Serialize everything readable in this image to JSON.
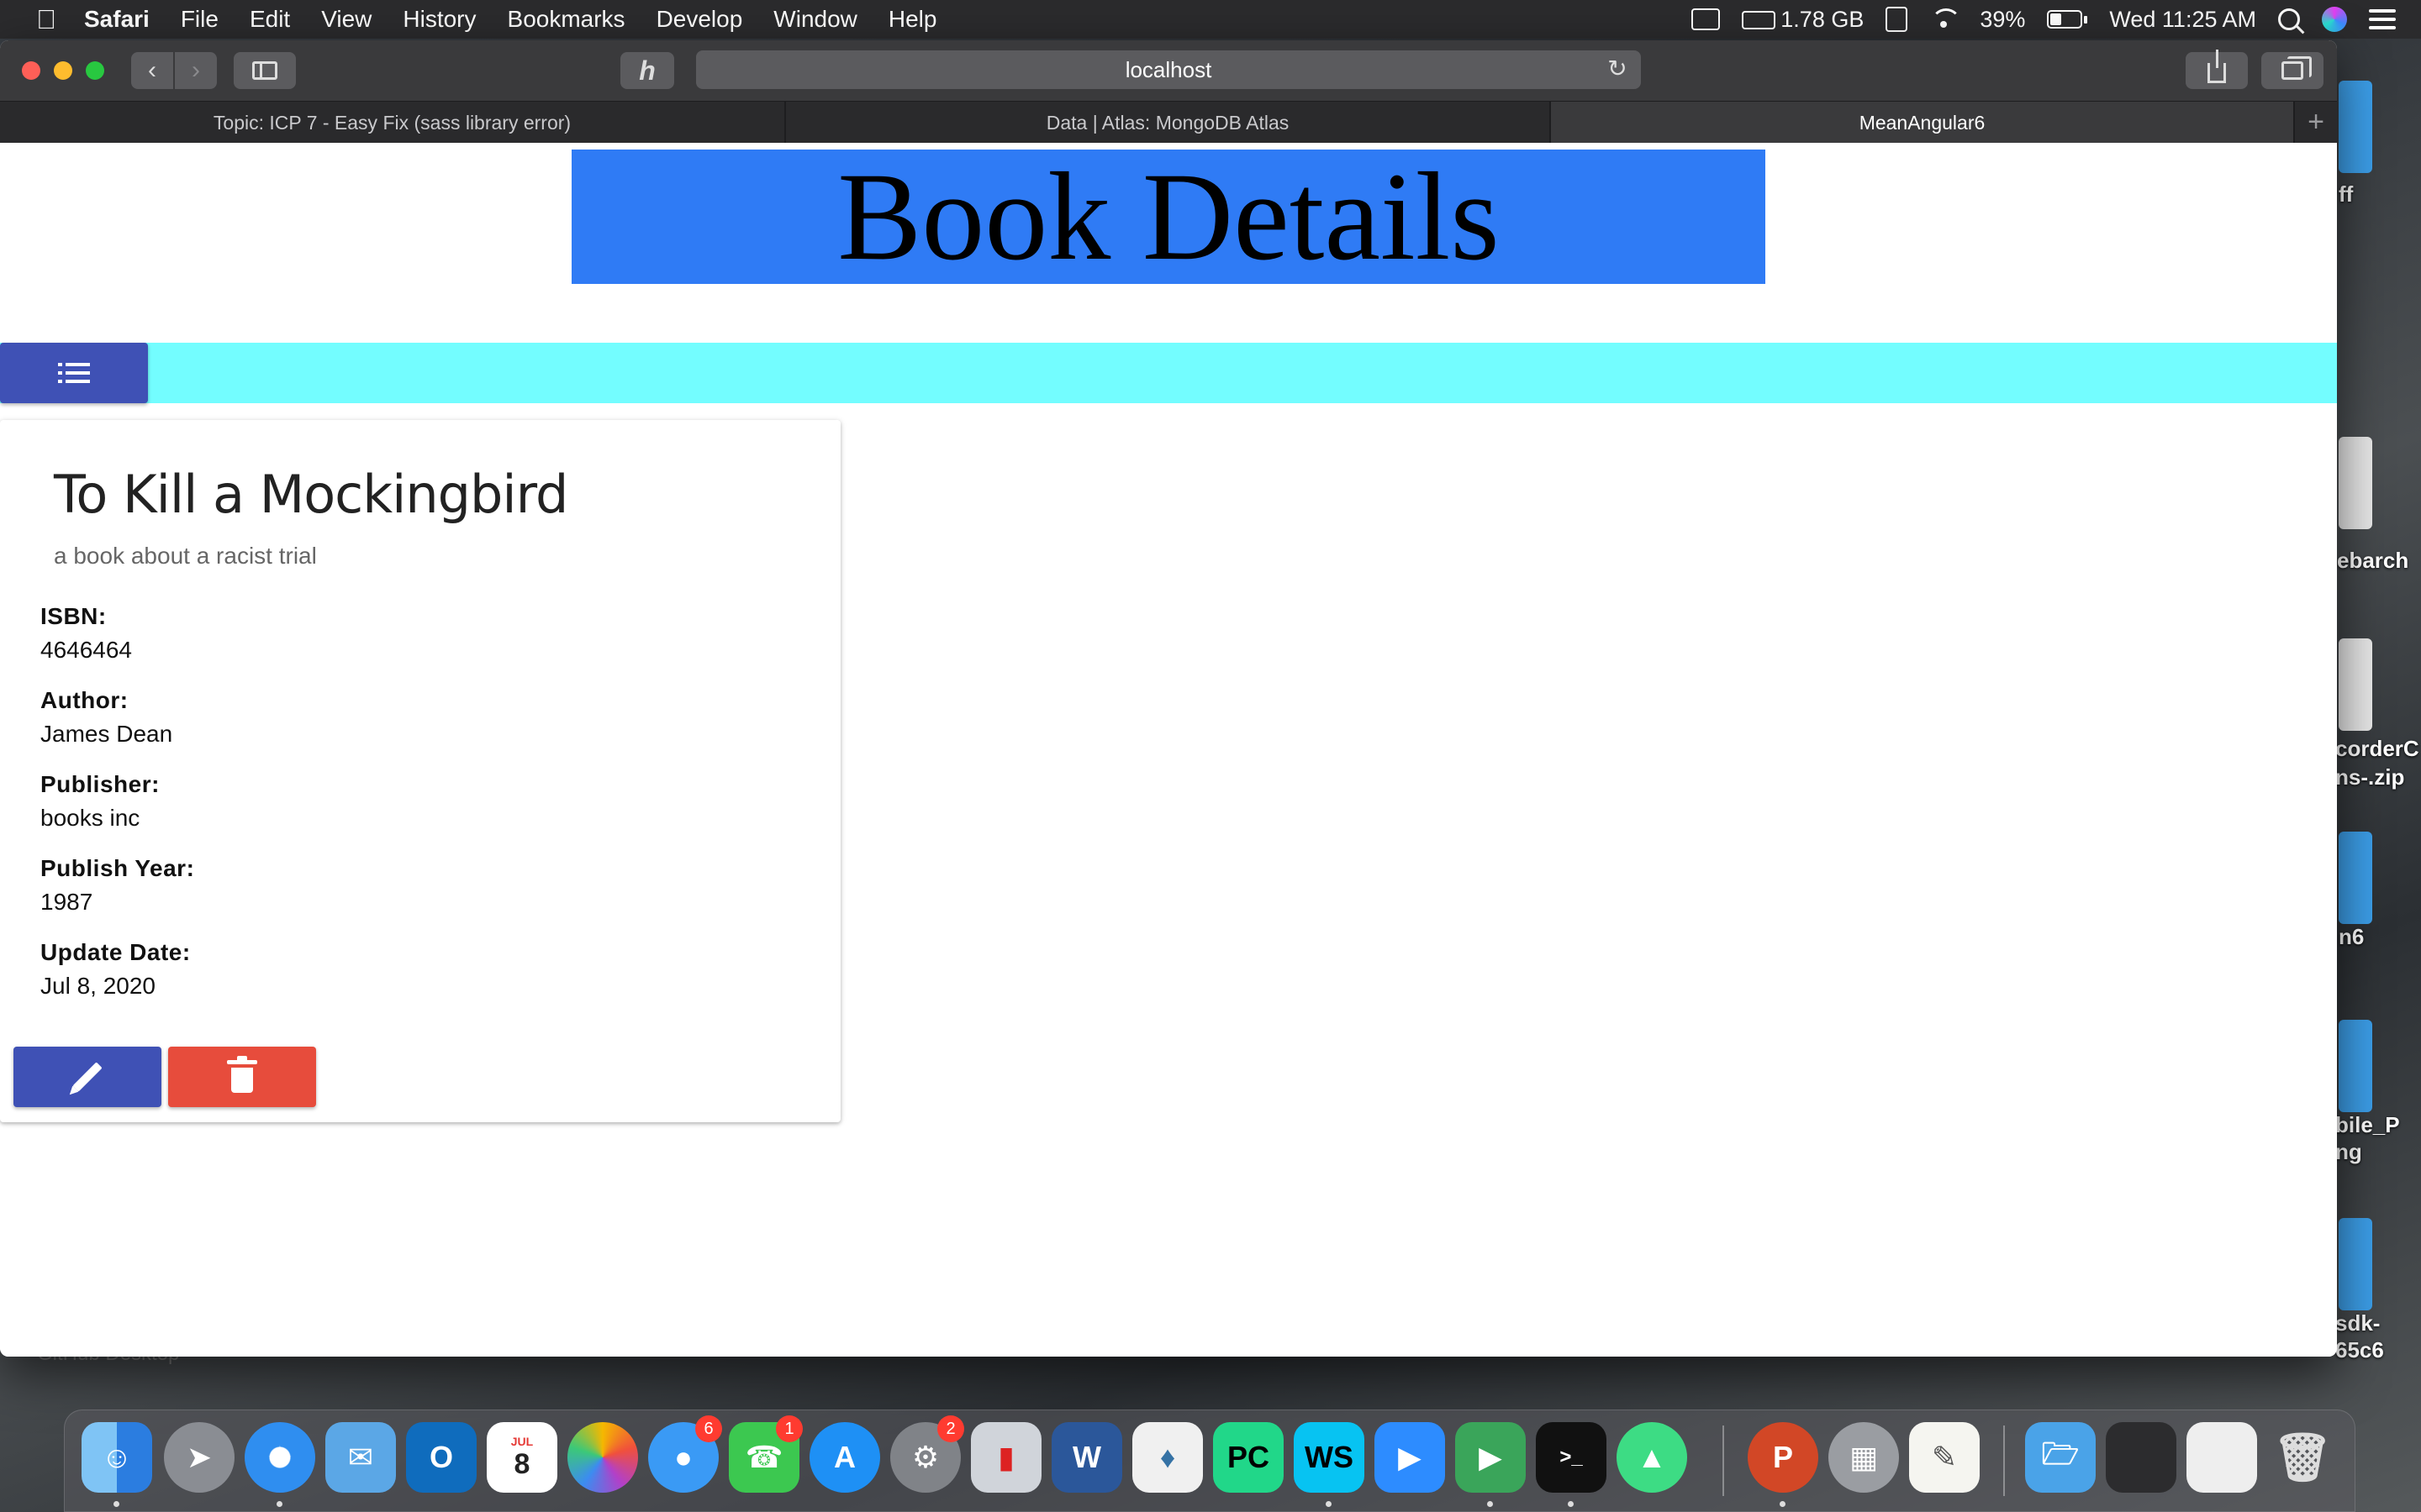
{
  "menubar": {
    "app_name": "Safari",
    "menus": [
      "File",
      "Edit",
      "View",
      "History",
      "Bookmarks",
      "Develop",
      "Window",
      "Help"
    ],
    "memory": "1.78 GB",
    "battery": "39%",
    "battery_level": 0.39,
    "clock": "Wed 11:25 AM"
  },
  "browser": {
    "address": "localhost",
    "tabs": [
      {
        "title": "Topic: ICP 7 - Easy Fix (sass library error)",
        "active": false
      },
      {
        "title": "Data | Atlas: MongoDB Atlas",
        "active": false
      },
      {
        "title": "MeanAngular6",
        "active": true
      }
    ],
    "new_tab_glyph": "+"
  },
  "page": {
    "header": "Book Details",
    "colors": {
      "header_bg": "#2f7bf5",
      "nav_strip": "#73fdff",
      "primary_button": "#3f51b5",
      "danger_button": "#e74c3c"
    },
    "book": {
      "title": "To Kill a Mockingbird",
      "description": "a book about a racist trial",
      "fields": [
        {
          "label": "ISBN:",
          "value": "4646464"
        },
        {
          "label": "Author:",
          "value": "James Dean"
        },
        {
          "label": "Publisher:",
          "value": "books inc"
        },
        {
          "label": "Publish Year:",
          "value": "1987"
        },
        {
          "label": "Update Date:",
          "value": "Jul 8, 2020"
        }
      ]
    },
    "icons": {
      "list_button": "format-list-icon",
      "edit_button": "pencil-icon",
      "delete_button": "trash-icon"
    }
  },
  "desktop": {
    "labels": [
      "ff",
      "ebarch",
      "corderC",
      "ns-.zip",
      "n6",
      "bile_P",
      "ng",
      "sdk-",
      "65c6"
    ],
    "behind_window_text": "GitHub Desktop"
  },
  "dock": {
    "badges": {
      "messages": "6",
      "facetime": "1",
      "system_preferences": "2"
    },
    "calendar_month": "JUL",
    "calendar_day": "8"
  }
}
